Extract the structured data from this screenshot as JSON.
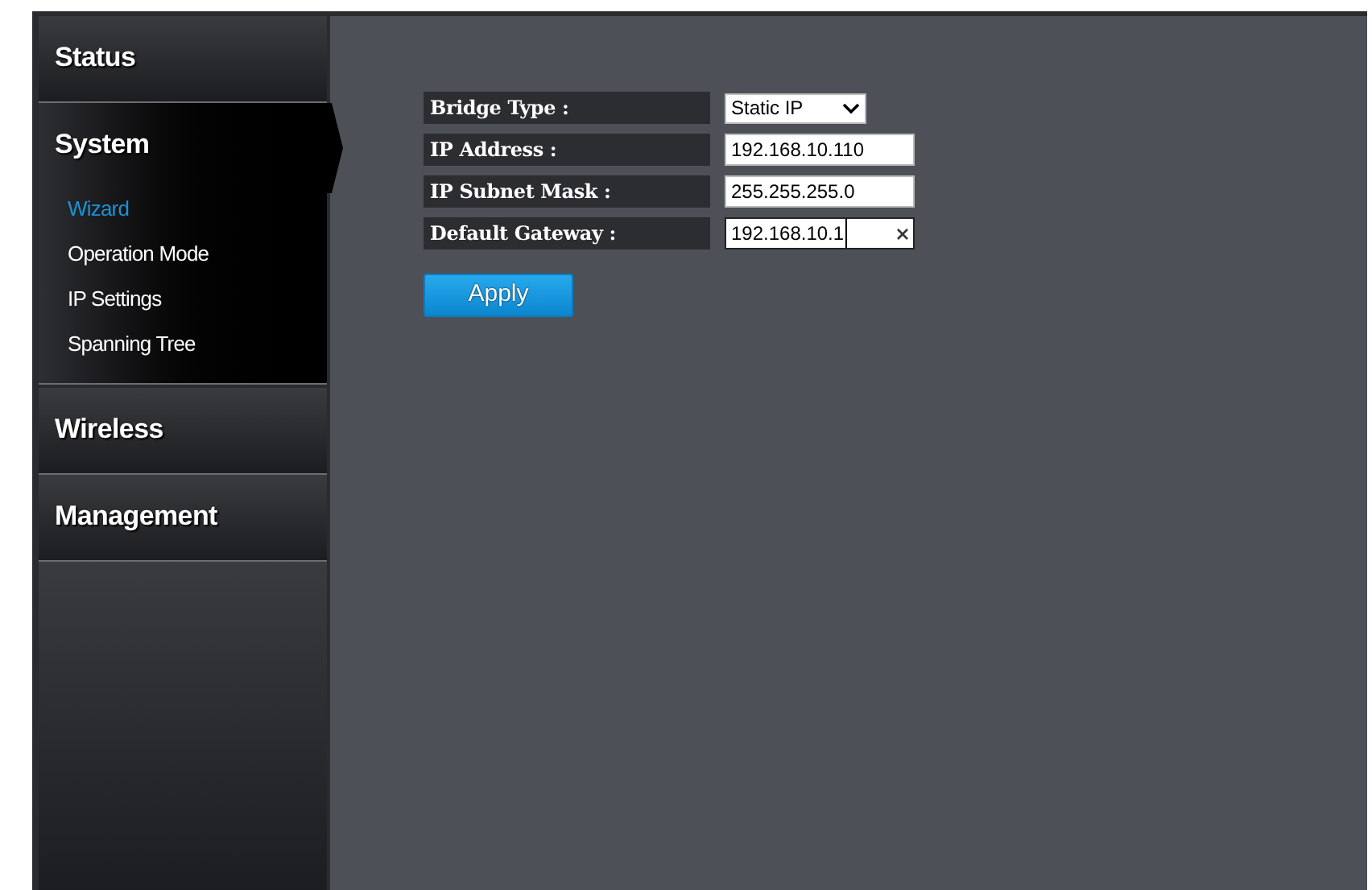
{
  "sidebar": {
    "sections": [
      {
        "label": "Status",
        "expanded": false
      },
      {
        "label": "System",
        "expanded": true,
        "items": [
          {
            "label": "Wizard",
            "selected": true
          },
          {
            "label": "Operation Mode",
            "selected": false
          },
          {
            "label": "IP Settings",
            "selected": false
          },
          {
            "label": "Spanning Tree",
            "selected": false
          }
        ]
      },
      {
        "label": "Wireless",
        "expanded": false
      },
      {
        "label": "Management",
        "expanded": false
      }
    ]
  },
  "form": {
    "fields": [
      {
        "label": "Bridge Type :",
        "kind": "select",
        "value": "Static IP"
      },
      {
        "label": "IP Address :",
        "kind": "text",
        "value": "192.168.10.110"
      },
      {
        "label": "IP Subnet Mask :",
        "kind": "text",
        "value": "255.255.255.0"
      },
      {
        "label": "Default Gateway :",
        "kind": "text",
        "value": "192.168.10.1",
        "focused": true
      }
    ],
    "button": "Apply"
  }
}
